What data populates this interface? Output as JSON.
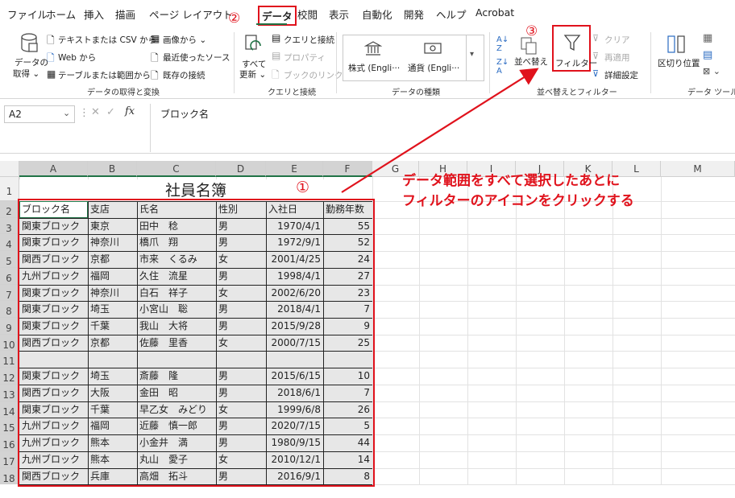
{
  "menu": {
    "items": [
      "ファイル",
      "ホーム",
      "挿入",
      "描画",
      "ページ レイアウト",
      "データ",
      "校閲",
      "表示",
      "自動化",
      "開発",
      "ヘルプ",
      "Acrobat"
    ],
    "active": "データ"
  },
  "ribbon": {
    "get_data": {
      "main_label_1": "データの",
      "main_label_2": "取得 ⌄",
      "text_csv": "テキストまたは CSV から",
      "web": "Web から",
      "table_range": "テーブルまたは範囲から",
      "from_image": "画像から ⌄",
      "recent_sources": "最近使ったソース",
      "existing_conn": "既存の接続",
      "group_label": "データの取得と変換"
    },
    "queries": {
      "refresh_all_1": "すべて",
      "refresh_all_2": "更新 ⌄",
      "queries_conn": "クエリと接続",
      "properties": "プロパティ",
      "book_links": "ブックのリンク",
      "group_label": "クエリと接続"
    },
    "data_types": {
      "stocks": "株式 (Engli···",
      "currency": "通貨 (Engli···",
      "group_label": "データの種類"
    },
    "sort_filter": {
      "sort": "並べ替え",
      "filter": "フィルター",
      "clear": "クリア",
      "reapply": "再適用",
      "advanced": "詳細設定",
      "group_label": "並べ替えとフィルター"
    },
    "data_tools": {
      "text_to_columns": "区切り位置",
      "group_label": "データ ツール"
    }
  },
  "formula_bar": {
    "name_box": "A2",
    "formula": "ブロック名"
  },
  "sheet": {
    "columns": [
      "A",
      "B",
      "C",
      "D",
      "E",
      "F",
      "G",
      "H",
      "I",
      "J",
      "K",
      "L",
      "M"
    ],
    "rows": [
      "1",
      "2",
      "3",
      "4",
      "5",
      "6",
      "7",
      "8",
      "9",
      "10",
      "11",
      "12",
      "13",
      "14",
      "15",
      "16",
      "17",
      "18"
    ],
    "title": "社員名簿",
    "headers": [
      "ブロック名",
      "支店",
      "氏名",
      "性別",
      "入社日",
      "勤務年数"
    ],
    "data": [
      [
        "関東ブロック",
        "東京",
        "田中　稔",
        "男",
        "1970/4/1",
        "55"
      ],
      [
        "関東ブロック",
        "神奈川",
        "橋爪　翔",
        "男",
        "1972/9/1",
        "52"
      ],
      [
        "関西ブロック",
        "京都",
        "市来　くるみ",
        "女",
        "2001/4/25",
        "24"
      ],
      [
        "九州ブロック",
        "福岡",
        "久住　流星",
        "男",
        "1998/4/1",
        "27"
      ],
      [
        "関東ブロック",
        "神奈川",
        "白石　祥子",
        "女",
        "2002/6/20",
        "23"
      ],
      [
        "関東ブロック",
        "埼玉",
        "小宮山　聡",
        "男",
        "2018/4/1",
        "7"
      ],
      [
        "関東ブロック",
        "千葉",
        "我山　大将",
        "男",
        "2015/9/28",
        "9"
      ],
      [
        "関西ブロック",
        "京都",
        "佐藤　里香",
        "女",
        "2000/7/15",
        "25"
      ],
      [
        "",
        "",
        "",
        "",
        "",
        ""
      ],
      [
        "関東ブロック",
        "埼玉",
        "斎藤　隆",
        "男",
        "2015/6/15",
        "10"
      ],
      [
        "関西ブロック",
        "大阪",
        "金田　昭",
        "男",
        "2018/6/1",
        "7"
      ],
      [
        "関東ブロック",
        "千葉",
        "早乙女　みどり",
        "女",
        "1999/6/8",
        "26"
      ],
      [
        "九州ブロック",
        "福岡",
        "近藤　慎一郎",
        "男",
        "2020/7/15",
        "5"
      ],
      [
        "九州ブロック",
        "熊本",
        "小金井　満",
        "男",
        "1980/9/15",
        "44"
      ],
      [
        "九州ブロック",
        "熊本",
        "丸山　愛子",
        "女",
        "2010/12/1",
        "14"
      ],
      [
        "関西ブロック",
        "兵庫",
        "高畑　拓斗",
        "男",
        "2016/9/1",
        "8"
      ]
    ]
  },
  "annotations": {
    "step1": "①",
    "step2": "②",
    "step3": "③",
    "instruction_line1": "データ範囲をすべて選択したあとに",
    "instruction_line2": "フィルターのアイコンをクリックする",
    "color": "#e0121c"
  },
  "colors": {
    "selection_fill": "#d4d4d4",
    "accent_green": "#217346",
    "annotation_red": "#e0121c"
  }
}
